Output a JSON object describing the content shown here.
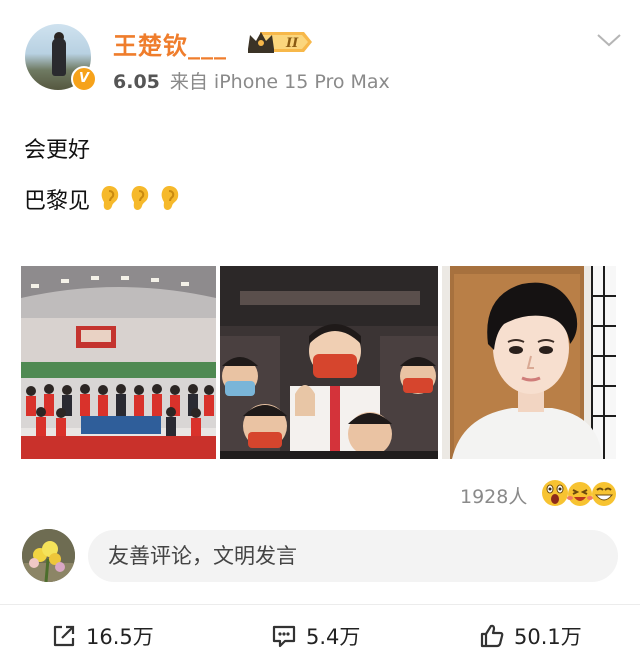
{
  "post": {
    "username": "王楚钦___",
    "level_badge": "II",
    "time": "6.05",
    "source": "来自 iPhone 15 Pro Max",
    "lines": [
      "会更好",
      "巴黎见"
    ],
    "ear_emoji_count": 3,
    "images": [
      {
        "name": "team-photo",
        "icon": "team-group-photo"
      },
      {
        "name": "ceremony-photo",
        "icon": "masked-athlete-photo"
      },
      {
        "name": "selfie-photo",
        "icon": "selfie-portrait-photo"
      }
    ]
  },
  "reactions": {
    "count": "1928人",
    "emojis": [
      "shocked-face",
      "laughing-face",
      "grinning-face"
    ]
  },
  "comment": {
    "placeholder": "友善评论，文明发言"
  },
  "actions": {
    "repost": "16.5万",
    "comments": "5.4万",
    "likes": "50.1万"
  },
  "colors": {
    "username": "#ef7d2c",
    "verified_badge": "#f6a21a",
    "meta_text": "#8a8a8a",
    "input_bg": "#f3f3f3"
  }
}
